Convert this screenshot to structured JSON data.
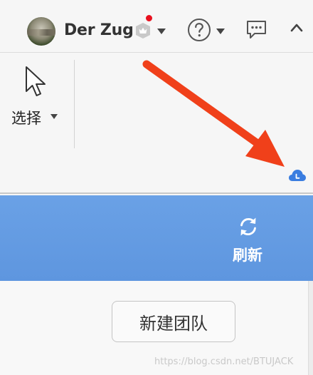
{
  "header": {
    "username": "Der Zug",
    "avatar_icon": "user-avatar-photo",
    "badge_icon": "shield-crown-icon",
    "notification_dot_color": "#e8101e",
    "help_icon": "question-circle-icon",
    "message_icon": "chat-bubble-icon",
    "collapse_icon": "chevron-up-icon"
  },
  "toolbar": {
    "select_label": "选择",
    "select_icon": "cursor-arrow-icon",
    "cloud_icon": "cloud-sync-icon",
    "cloud_color": "#3a7de0"
  },
  "annotation": {
    "arrow_color": "#f0401a",
    "points_to": "cloud-sync-icon"
  },
  "banner": {
    "background_color": "#6aa1e6",
    "refresh_label": "刷新",
    "refresh_icon": "refresh-icon"
  },
  "content": {
    "new_team_label": "新建团队"
  },
  "watermark": {
    "text": "https://blog.csdn.net/BTUJACK"
  }
}
